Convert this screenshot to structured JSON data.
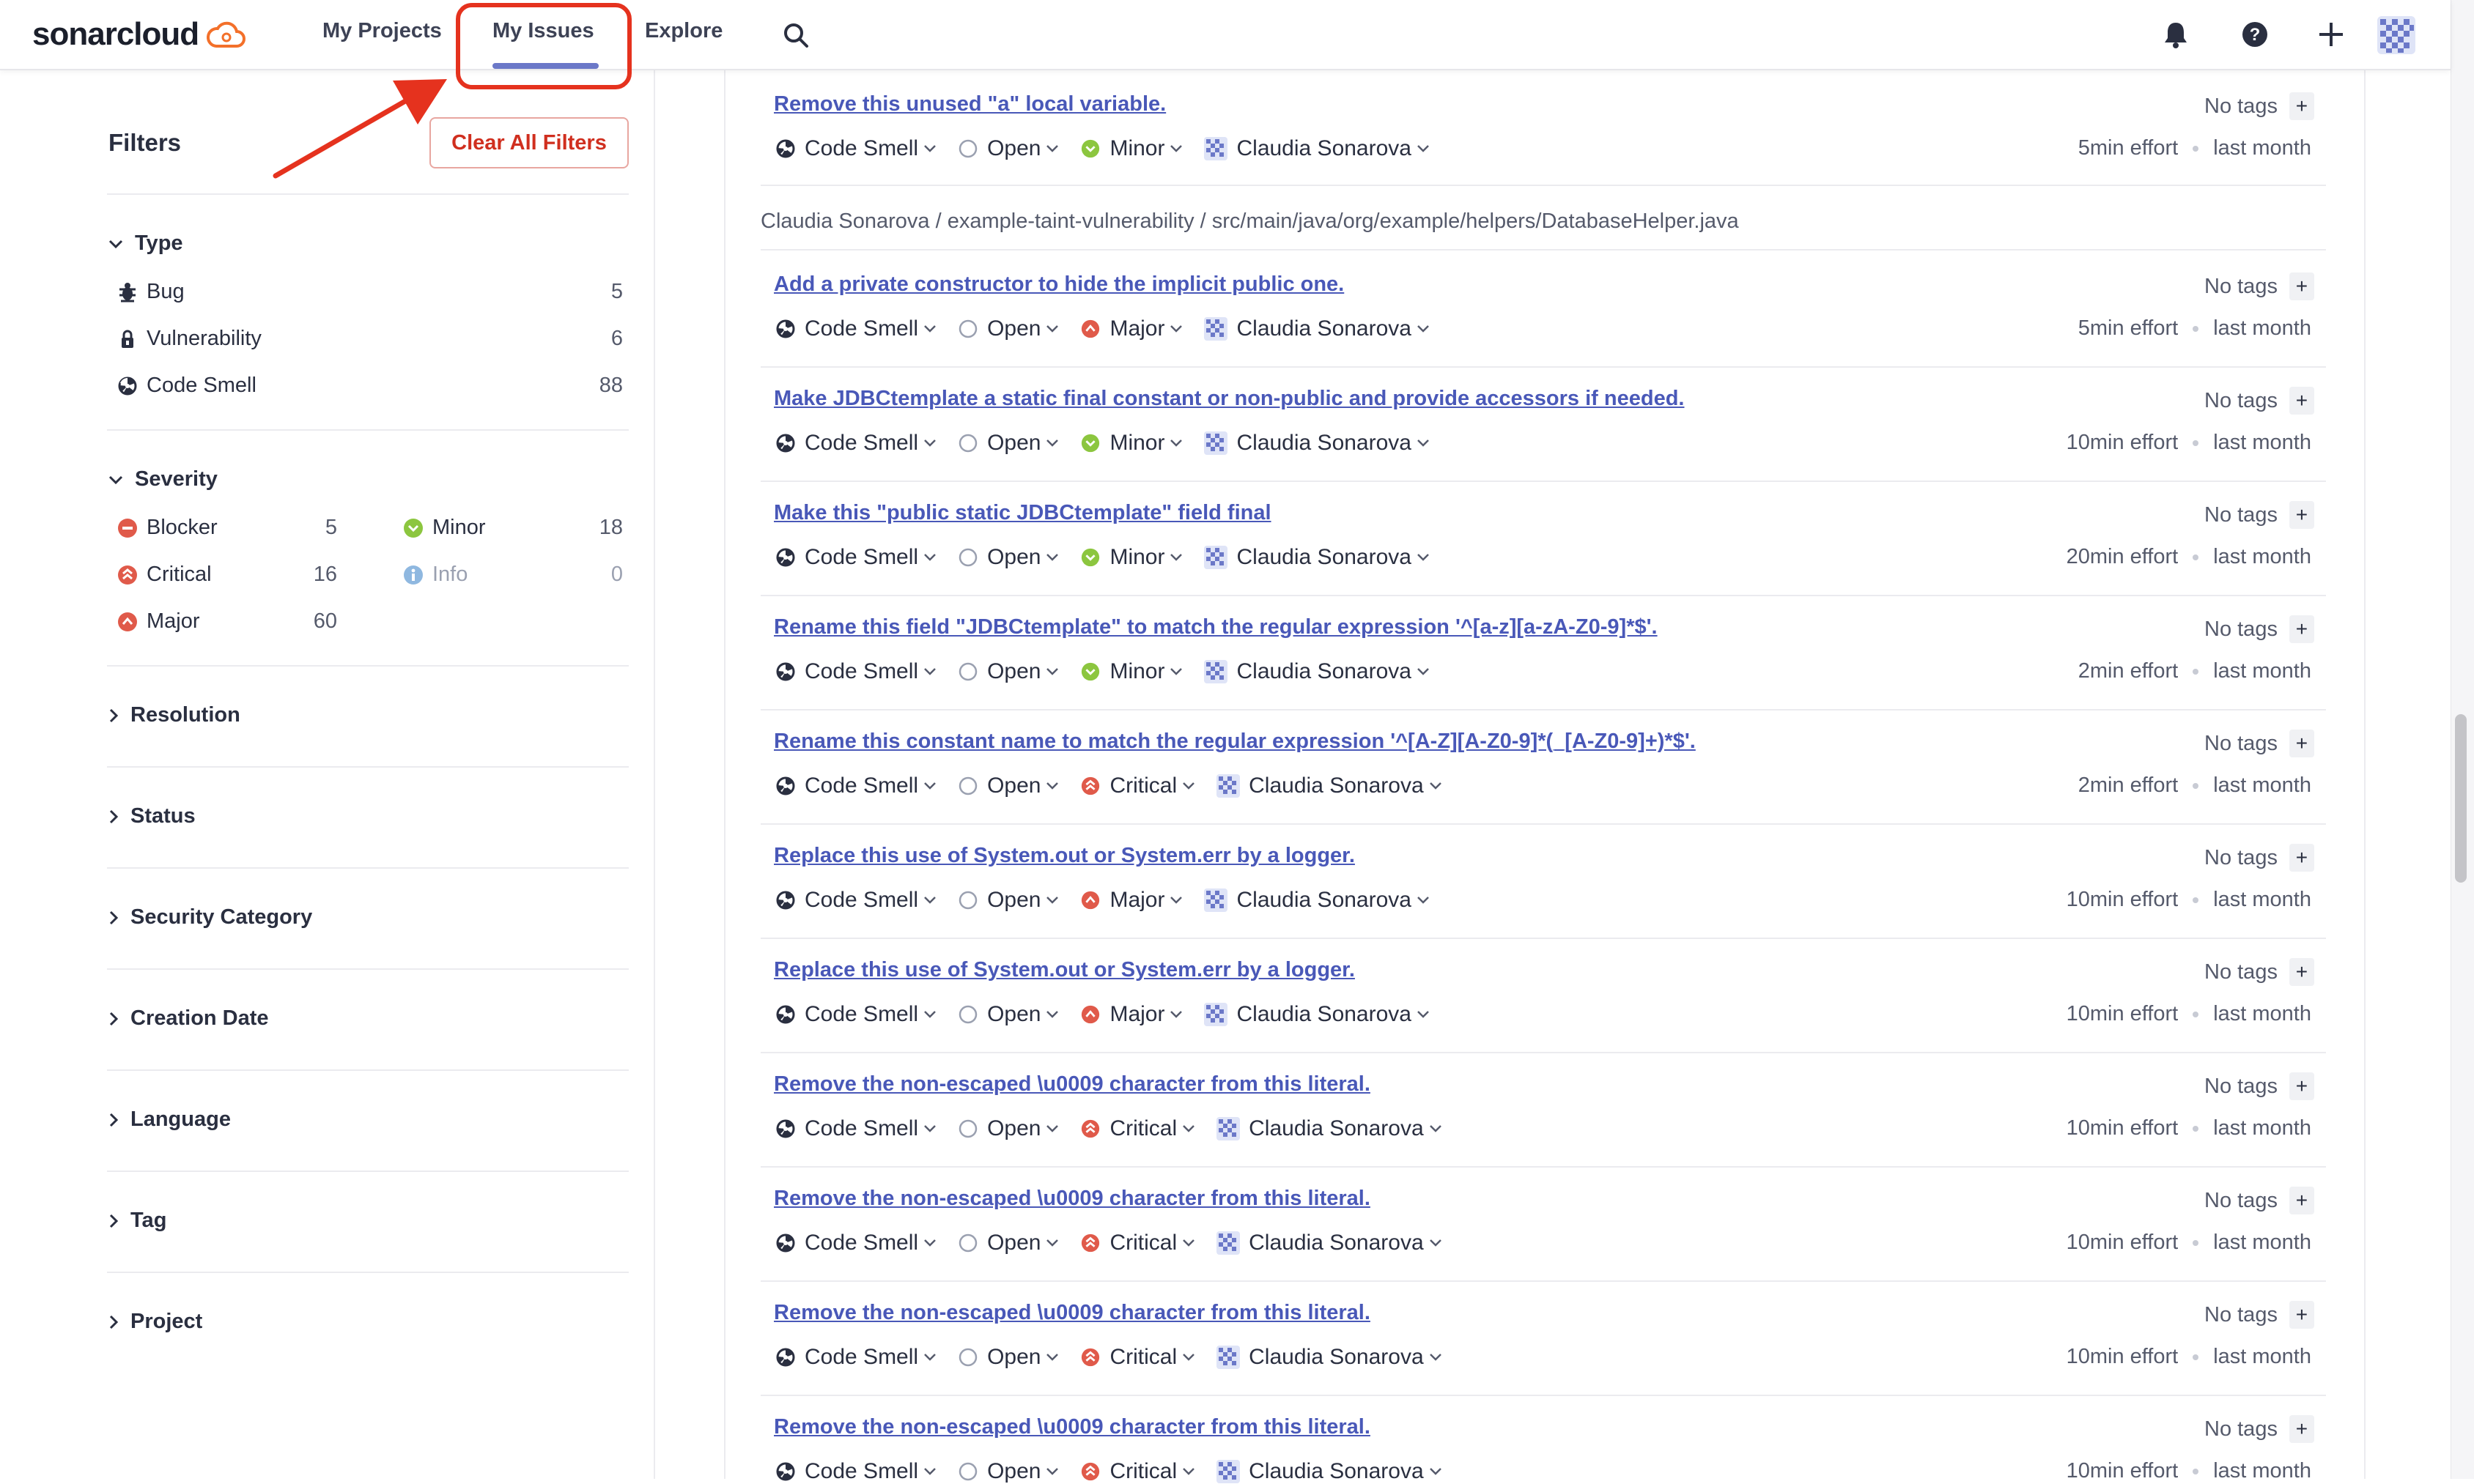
{
  "app": {
    "logo_text": "sonarcloud"
  },
  "nav": {
    "my_projects": "My Projects",
    "my_issues": "My Issues",
    "explore": "Explore"
  },
  "colors": {
    "accent": "#4958b8",
    "highlight_red": "#e5321e"
  },
  "sidebar": {
    "filters_title": "Filters",
    "clear_all_label": "Clear All Filters",
    "type": {
      "title": "Type",
      "items": [
        {
          "label": "Bug",
          "count": "5",
          "icon": "bug-icon"
        },
        {
          "label": "Vulnerability",
          "count": "6",
          "icon": "lock-icon"
        },
        {
          "label": "Code Smell",
          "count": "88",
          "icon": "code-smell-icon"
        }
      ]
    },
    "severity": {
      "title": "Severity",
      "items": [
        {
          "label": "Blocker",
          "count": "5",
          "icon": "blocker-icon"
        },
        {
          "label": "Minor",
          "count": "18",
          "icon": "minor-icon"
        },
        {
          "label": "Critical",
          "count": "16",
          "icon": "critical-icon"
        },
        {
          "label": "Info",
          "count": "0",
          "icon": "info-icon"
        },
        {
          "label": "Major",
          "count": "60",
          "icon": "major-icon"
        }
      ]
    },
    "collapsed_sections": [
      "Resolution",
      "Status",
      "Security Category",
      "Creation Date",
      "Language",
      "Tag",
      "Project"
    ]
  },
  "file_path": "Claudia Sonarova / example-taint-vulnerability / src/main/java/org/example/helpers/DatabaseHelper.java",
  "issues": [
    {
      "title": "Remove this unused \"a\" local variable.",
      "type": "Code Smell",
      "status": "Open",
      "severity": "Minor",
      "assignee": "Claudia Sonarova",
      "tags": "No tags",
      "effort": "5min effort",
      "date": "last month"
    },
    {
      "title": "Add a private constructor to hide the implicit public one.",
      "type": "Code Smell",
      "status": "Open",
      "severity": "Major",
      "assignee": "Claudia Sonarova",
      "tags": "No tags",
      "effort": "5min effort",
      "date": "last month"
    },
    {
      "title": "Make JDBCtemplate a static final constant or non-public and provide accessors if needed.",
      "type": "Code Smell",
      "status": "Open",
      "severity": "Minor",
      "assignee": "Claudia Sonarova",
      "tags": "No tags",
      "effort": "10min effort",
      "date": "last month"
    },
    {
      "title": "Make this \"public static JDBCtemplate\" field final",
      "type": "Code Smell",
      "status": "Open",
      "severity": "Minor",
      "assignee": "Claudia Sonarova",
      "tags": "No tags",
      "effort": "20min effort",
      "date": "last month"
    },
    {
      "title": "Rename this field \"JDBCtemplate\" to match the regular expression '^[a-z][a-zA-Z0-9]*$'.",
      "type": "Code Smell",
      "status": "Open",
      "severity": "Minor",
      "assignee": "Claudia Sonarova",
      "tags": "No tags",
      "effort": "2min effort",
      "date": "last month"
    },
    {
      "title": "Rename this constant name to match the regular expression '^[A-Z][A-Z0-9]*(_[A-Z0-9]+)*$'.",
      "type": "Code Smell",
      "status": "Open",
      "severity": "Critical",
      "assignee": "Claudia Sonarova",
      "tags": "No tags",
      "effort": "2min effort",
      "date": "last month"
    },
    {
      "title": "Replace this use of System.out or System.err by a logger.",
      "type": "Code Smell",
      "status": "Open",
      "severity": "Major",
      "assignee": "Claudia Sonarova",
      "tags": "No tags",
      "effort": "10min effort",
      "date": "last month"
    },
    {
      "title": "Replace this use of System.out or System.err by a logger.",
      "type": "Code Smell",
      "status": "Open",
      "severity": "Major",
      "assignee": "Claudia Sonarova",
      "tags": "No tags",
      "effort": "10min effort",
      "date": "last month"
    },
    {
      "title": "Remove the non-escaped \\u0009 character from this literal.",
      "type": "Code Smell",
      "status": "Open",
      "severity": "Critical",
      "assignee": "Claudia Sonarova",
      "tags": "No tags",
      "effort": "10min effort",
      "date": "last month"
    },
    {
      "title": "Remove the non-escaped \\u0009 character from this literal.",
      "type": "Code Smell",
      "status": "Open",
      "severity": "Critical",
      "assignee": "Claudia Sonarova",
      "tags": "No tags",
      "effort": "10min effort",
      "date": "last month"
    },
    {
      "title": "Remove the non-escaped \\u0009 character from this literal.",
      "type": "Code Smell",
      "status": "Open",
      "severity": "Critical",
      "assignee": "Claudia Sonarova",
      "tags": "No tags",
      "effort": "10min effort",
      "date": "last month"
    },
    {
      "title": "Remove the non-escaped \\u0009 character from this literal.",
      "type": "Code Smell",
      "status": "Open",
      "severity": "Critical",
      "assignee": "Claudia Sonarova",
      "tags": "No tags",
      "effort": "10min effort",
      "date": "last month"
    }
  ]
}
